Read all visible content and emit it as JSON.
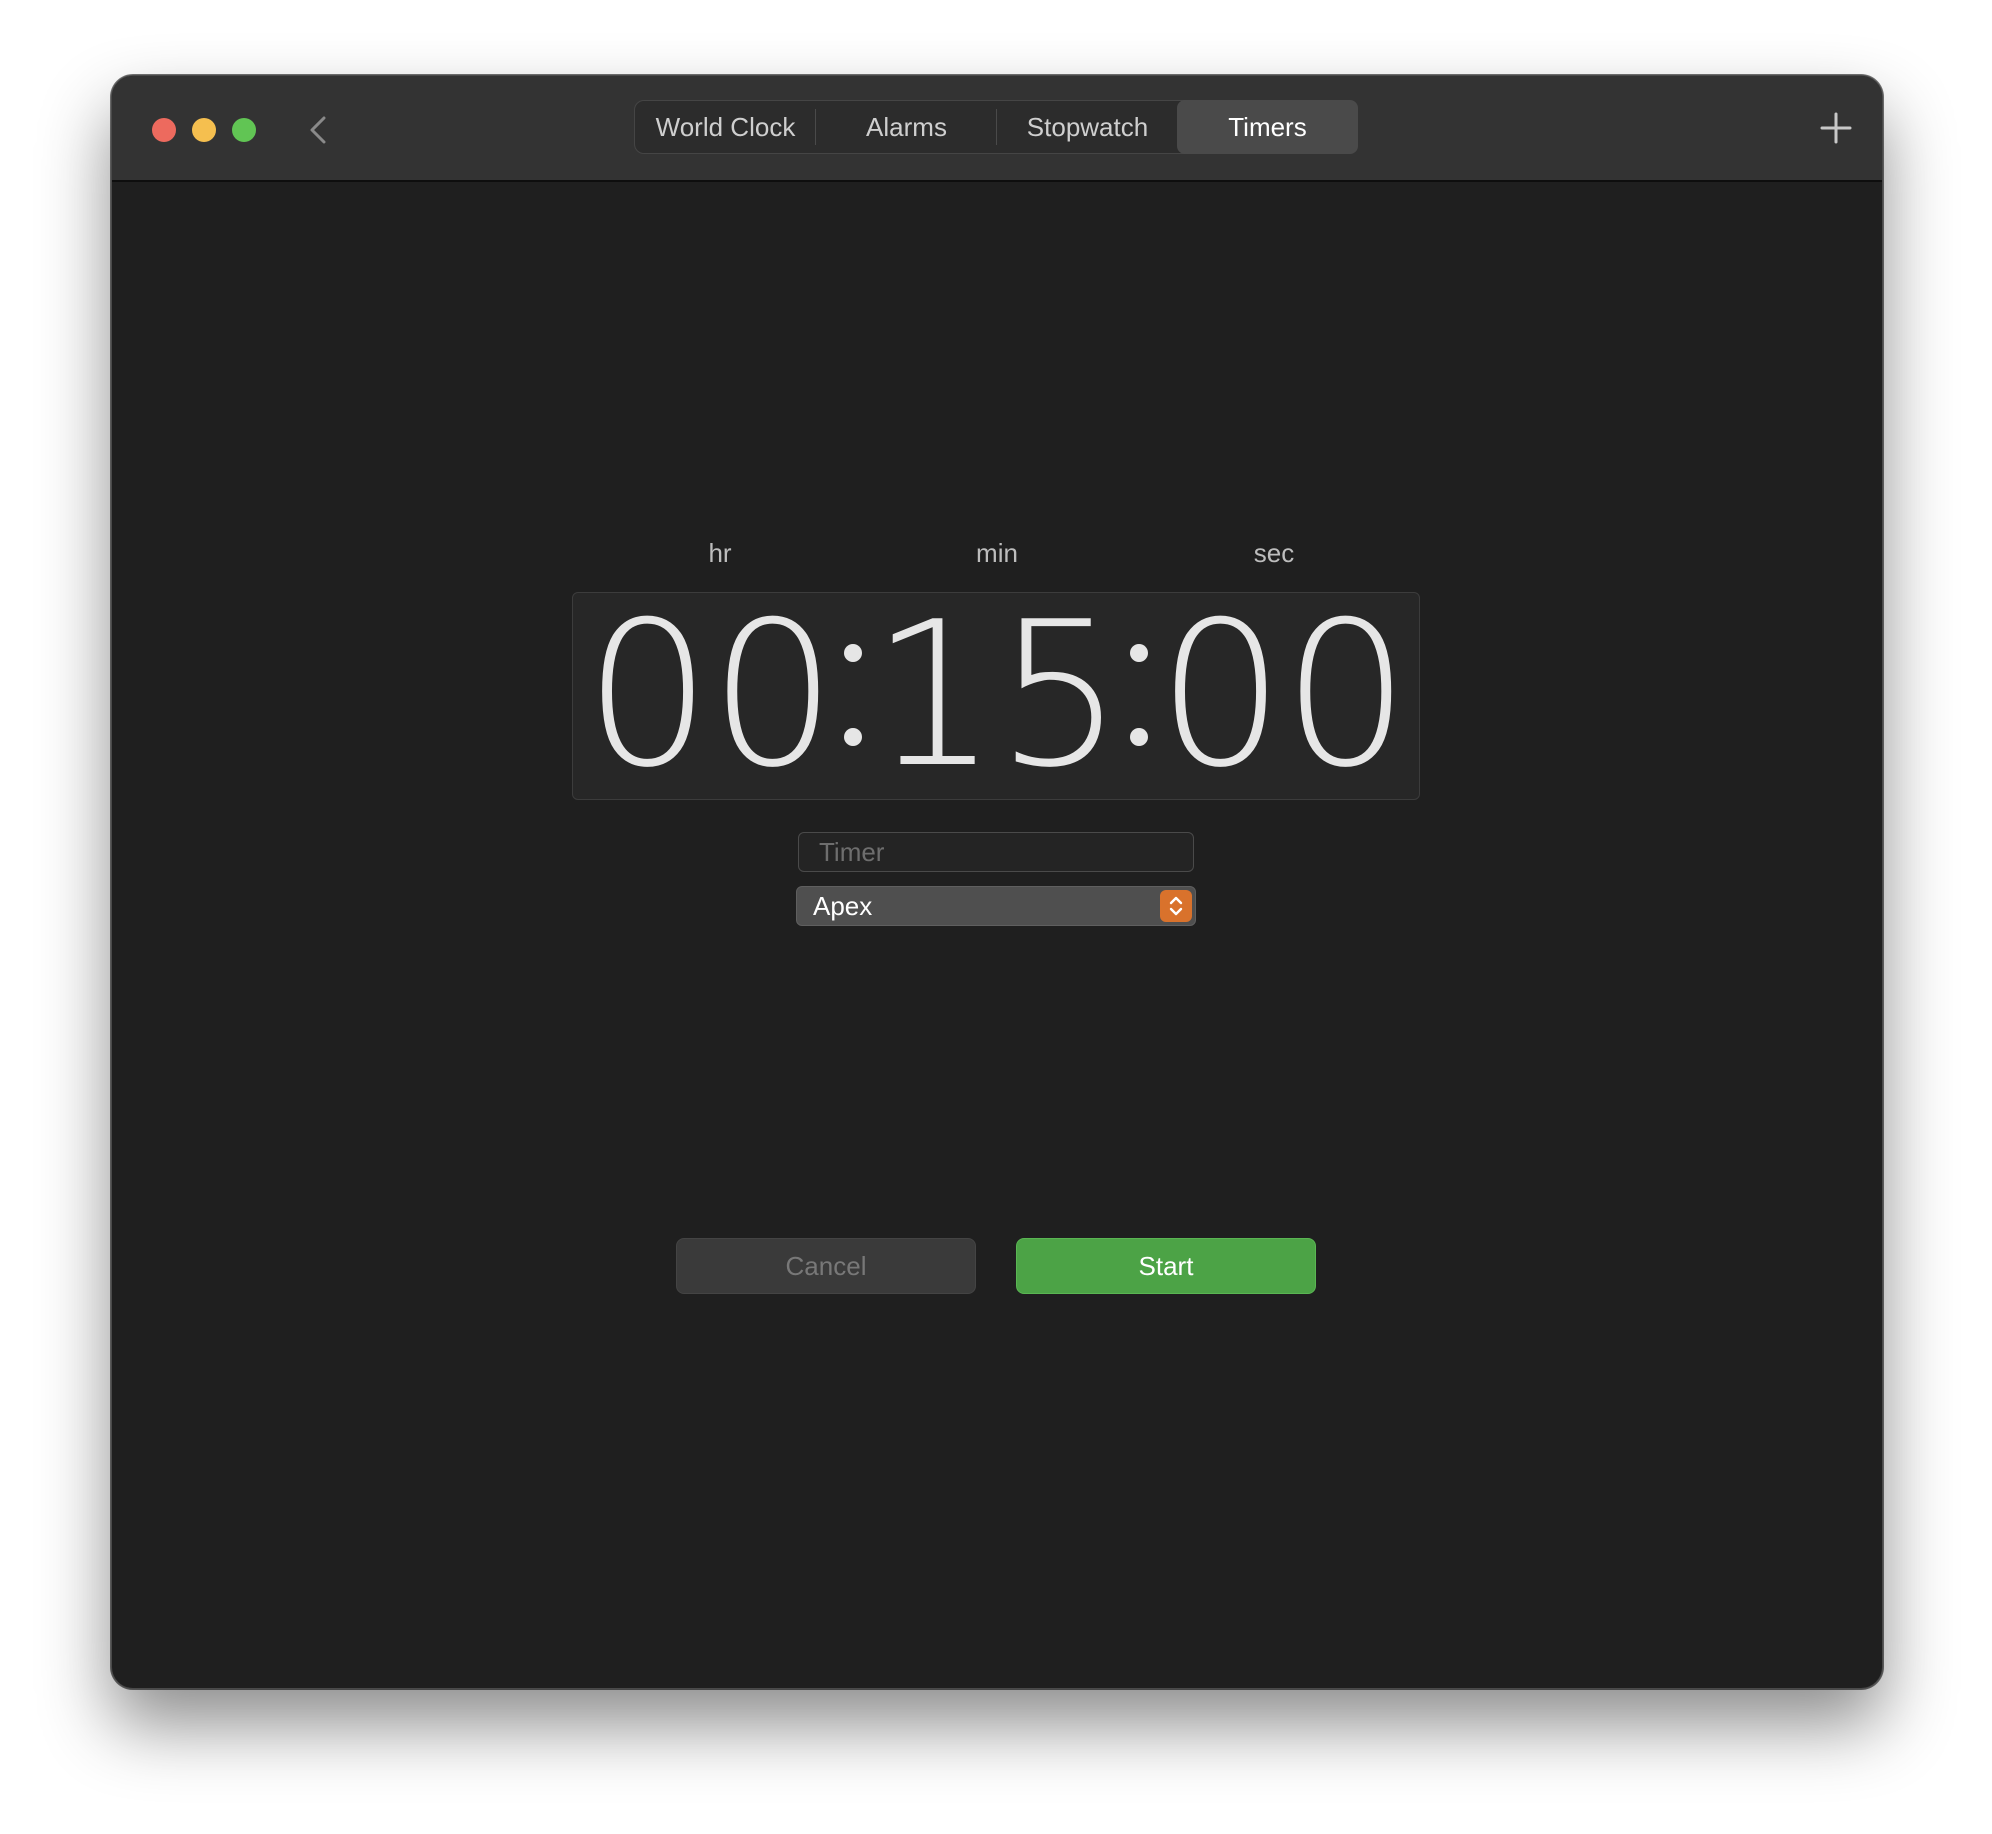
{
  "window": {
    "traffic_lights": {
      "close_color": "#ed6a5e",
      "minimize_color": "#f5bf4f",
      "zoom_color": "#61c554"
    },
    "back_icon": "chevron-left-icon",
    "add_icon": "plus-icon"
  },
  "tabs": [
    {
      "label": "World Clock",
      "active": false
    },
    {
      "label": "Alarms",
      "active": false
    },
    {
      "label": "Stopwatch",
      "active": false
    },
    {
      "label": "Timers",
      "active": true
    }
  ],
  "timer": {
    "units": {
      "hr": "hr",
      "min": "min",
      "sec": "sec"
    },
    "hours": "00",
    "minutes": "15",
    "seconds": "00",
    "label_field": {
      "value": "",
      "placeholder": "Timer"
    },
    "sound": {
      "selected": "Apex"
    }
  },
  "buttons": {
    "cancel": "Cancel",
    "start": "Start"
  },
  "colors": {
    "accent_stepper": "#d9722c",
    "start_green": "#4ca346"
  }
}
